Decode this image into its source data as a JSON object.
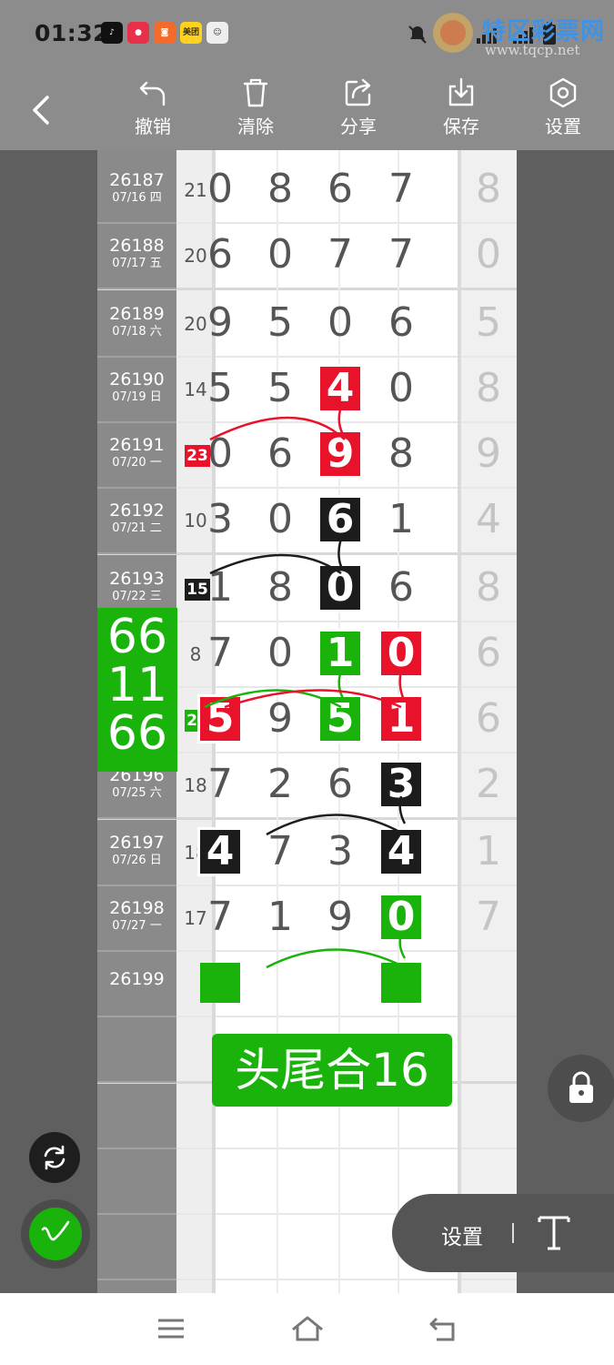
{
  "status_bar": {
    "time": "01:32",
    "app_icons": [
      "tiktok-icon",
      "app-icon-red",
      "app-icon-orange",
      "meituan-icon",
      "avatar-icon"
    ],
    "meituan_text": "美团",
    "right_icons": [
      "mute-icon",
      "4g-signal-icon",
      "4g-signal-icon",
      "battery-icon"
    ]
  },
  "watermark": {
    "text": "特区彩票网",
    "url": "www.tqcp.net"
  },
  "toolbar": {
    "back_icon": "chevron-left-icon",
    "buttons": [
      {
        "label": "撤销",
        "icon": "undo-icon"
      },
      {
        "label": "清除",
        "icon": "trash-icon"
      },
      {
        "label": "分享",
        "icon": "share-icon"
      },
      {
        "label": "保存",
        "icon": "download-icon"
      },
      {
        "label": "设置",
        "icon": "settings-hex-icon"
      }
    ]
  },
  "rows": [
    {
      "issue": "26187",
      "date": "07/16 四",
      "span": "21",
      "digits": [
        "0",
        "8",
        "6",
        "7"
      ],
      "extra": "8"
    },
    {
      "issue": "26188",
      "date": "07/17 五",
      "span": "20",
      "digits": [
        "6",
        "0",
        "7",
        "7"
      ],
      "extra": "0"
    },
    {
      "issue": "26189",
      "date": "07/18 六",
      "span": "20",
      "digits": [
        "9",
        "5",
        "0",
        "6"
      ],
      "extra": "5"
    },
    {
      "issue": "26190",
      "date": "07/19 日",
      "span": "14",
      "digits": [
        "5",
        "5",
        "4",
        "0"
      ],
      "extra": "8"
    },
    {
      "issue": "26191",
      "date": "07/20 一",
      "span": "23",
      "digits": [
        "0",
        "6",
        "9",
        "8"
      ],
      "extra": "9"
    },
    {
      "issue": "26192",
      "date": "07/21 二",
      "span": "10",
      "digits": [
        "3",
        "0",
        "6",
        "1"
      ],
      "extra": "4"
    },
    {
      "issue": "26193",
      "date": "07/22 三",
      "span": "15",
      "digits": [
        "1",
        "8",
        "0",
        "6"
      ],
      "extra": "8"
    },
    {
      "issue": "",
      "date": "",
      "span": "8",
      "digits": [
        "7",
        "0",
        "1",
        "0"
      ],
      "extra": "6"
    },
    {
      "issue": "",
      "date": "",
      "span": "20",
      "digits": [
        "5",
        "9",
        "5",
        "1"
      ],
      "extra": "6"
    },
    {
      "issue": "26196",
      "date": "07/25 六",
      "span": "18",
      "digits": [
        "7",
        "2",
        "6",
        "3"
      ],
      "extra": "2"
    },
    {
      "issue": "26197",
      "date": "07/26 日",
      "span": "18",
      "digits": [
        "4",
        "7",
        "3",
        "4"
      ],
      "extra": "1"
    },
    {
      "issue": "26198",
      "date": "07/27 一",
      "span": "17",
      "digits": [
        "7",
        "1",
        "9",
        "0"
      ],
      "extra": "7"
    },
    {
      "issue": "26199",
      "date": "",
      "span": "",
      "digits": [
        "",
        "",
        "",
        ""
      ],
      "extra": ""
    }
  ],
  "annotations": {
    "big_label": [
      "66",
      "11",
      "66"
    ],
    "banner": "头尾合16",
    "colors": {
      "red": "#e8122a",
      "black": "#1c1c1c",
      "green": "#19b30b"
    }
  },
  "floating": {
    "lock_icon": "lock-icon",
    "refresh_icon": "refresh-icon",
    "pen_icon": "pen-icon",
    "settings_label": "设置",
    "text_tool_icon": "text-tool-icon"
  },
  "navbar": {
    "icons": [
      "menu-icon",
      "home-icon",
      "back-icon"
    ]
  }
}
